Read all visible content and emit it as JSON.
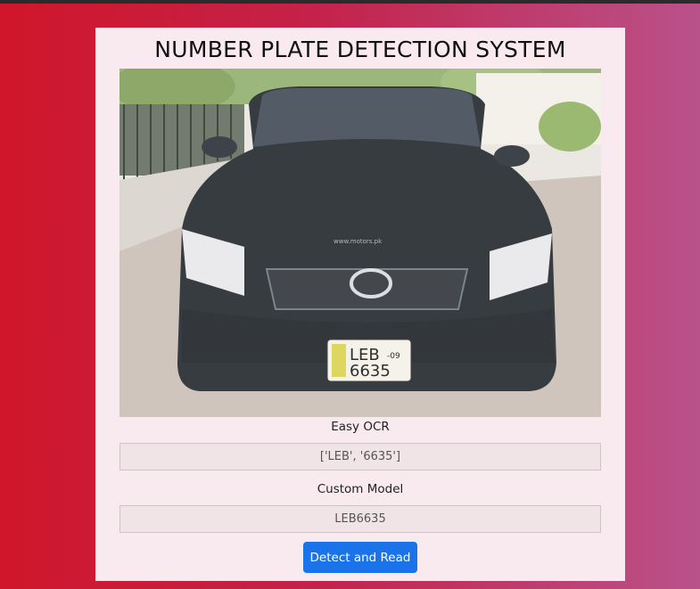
{
  "page": {
    "title": "NUMBER PLATE DETECTION SYSTEM"
  },
  "image": {
    "description_icon": "car-photo",
    "plate_text_line1": "LEB",
    "plate_text_suffix": "-09",
    "plate_text_line2": "6635",
    "watermark": "www.motors.pk"
  },
  "easy_ocr": {
    "label": "Easy OCR",
    "value": "['LEB', '6635']"
  },
  "custom_model": {
    "label": "Custom Model",
    "value": "LEB6635"
  },
  "actions": {
    "detect_label": "Detect and Read"
  },
  "colors": {
    "accent": "#1a73e8",
    "gradient_start": "#d0162a",
    "gradient_end": "#b9528a",
    "card_background": "#f8eaee"
  }
}
